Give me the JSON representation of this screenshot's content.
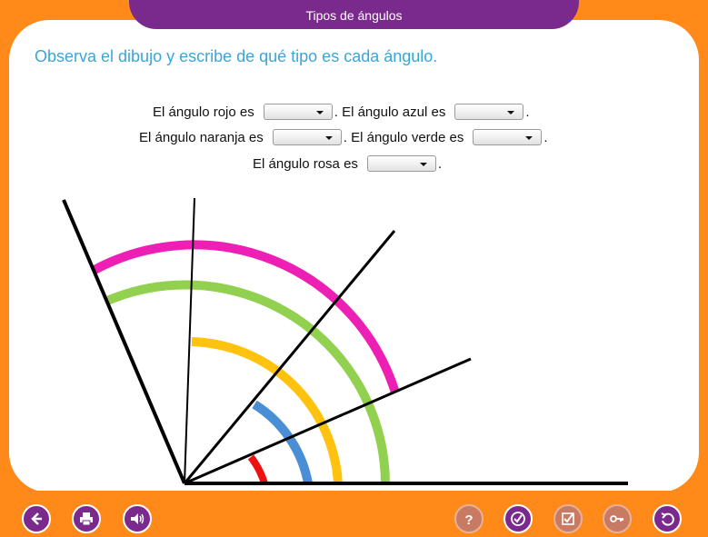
{
  "header": {
    "title": "Tipos de ángulos"
  },
  "instruction": "Observa el dibujo y escribe de qué tipo es cada ángulo.",
  "sentences": {
    "s1a": "El ángulo rojo es",
    "s1b": ". El ángulo azul es",
    "s1c": ".",
    "s2a": "El ángulo naranja es",
    "s2b": ". El ángulo verde es",
    "s2c": ".",
    "s3a": "El ángulo rosa es",
    "s3b": "."
  },
  "dropdowns": {
    "rojo": "",
    "azul": "",
    "naranja": "",
    "verde": "",
    "rosa": ""
  },
  "colors": {
    "rojo": "#ee1111",
    "azul": "#4a8fd6",
    "naranja": "#ffc20e",
    "verde": "#92d050",
    "rosa": "#ee1fb4",
    "brand": "#7a2a8c",
    "instruction": "#3aa6d8",
    "frame": "#ff8a1a"
  },
  "toolbar": {
    "left": [
      "back-icon",
      "print-icon",
      "audio-icon"
    ],
    "right": [
      "help-icon",
      "check-icon",
      "review-icon",
      "key-icon",
      "undo-icon"
    ]
  }
}
